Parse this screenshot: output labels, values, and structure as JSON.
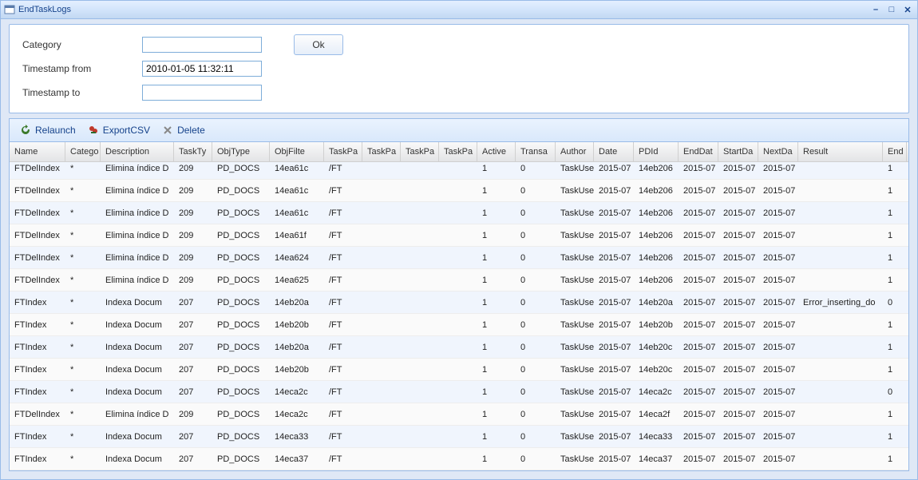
{
  "window": {
    "title": "EndTaskLogs"
  },
  "form": {
    "category_label": "Category",
    "category_value": "",
    "ts_from_label": "Timestamp from",
    "ts_from_value": "2010-01-05 11:32:11",
    "ts_to_label": "Timestamp to",
    "ts_to_value": "",
    "ok_label": "Ok"
  },
  "toolbar": {
    "relaunch": "Relaunch",
    "exportcsv": "ExportCSV",
    "delete": "Delete"
  },
  "columns": [
    "Name",
    "Catego",
    "Description",
    "TaskTy",
    "ObjType",
    "ObjFilte",
    "TaskPa",
    "TaskPa",
    "TaskPa",
    "TaskPa",
    "Active",
    "Transa",
    "Author",
    "Date",
    "PDId",
    "EndDat",
    "StartDa",
    "NextDa",
    "Result",
    "End"
  ],
  "rows": [
    {
      "name": "FTDelIndex",
      "cat": "*",
      "desc": "Elimina índice D",
      "tasktype": "209",
      "objtype": "PD_DOCS",
      "objfilter": "14ea61c",
      "tp1": "/FT",
      "tp2": "",
      "tp3": "",
      "tp4": "",
      "active": "1",
      "trans": "0",
      "author": "TaskUse",
      "date": "2015-07",
      "pdid": "14eb206",
      "enddate": "2015-07",
      "startdate": "2015-07",
      "nextdate": "2015-07",
      "result": "",
      "end": "1"
    },
    {
      "name": "FTDelIndex",
      "cat": "*",
      "desc": "Elimina índice D",
      "tasktype": "209",
      "objtype": "PD_DOCS",
      "objfilter": "14ea61c",
      "tp1": "/FT",
      "tp2": "",
      "tp3": "",
      "tp4": "",
      "active": "1",
      "trans": "0",
      "author": "TaskUse",
      "date": "2015-07",
      "pdid": "14eb206",
      "enddate": "2015-07",
      "startdate": "2015-07",
      "nextdate": "2015-07",
      "result": "",
      "end": "1"
    },
    {
      "name": "FTDelIndex",
      "cat": "*",
      "desc": "Elimina índice D",
      "tasktype": "209",
      "objtype": "PD_DOCS",
      "objfilter": "14ea61c",
      "tp1": "/FT",
      "tp2": "",
      "tp3": "",
      "tp4": "",
      "active": "1",
      "trans": "0",
      "author": "TaskUse",
      "date": "2015-07",
      "pdid": "14eb206",
      "enddate": "2015-07",
      "startdate": "2015-07",
      "nextdate": "2015-07",
      "result": "",
      "end": "1"
    },
    {
      "name": "FTDelIndex",
      "cat": "*",
      "desc": "Elimina índice D",
      "tasktype": "209",
      "objtype": "PD_DOCS",
      "objfilter": "14ea61f",
      "tp1": "/FT",
      "tp2": "",
      "tp3": "",
      "tp4": "",
      "active": "1",
      "trans": "0",
      "author": "TaskUse",
      "date": "2015-07",
      "pdid": "14eb206",
      "enddate": "2015-07",
      "startdate": "2015-07",
      "nextdate": "2015-07",
      "result": "",
      "end": "1"
    },
    {
      "name": "FTDelIndex",
      "cat": "*",
      "desc": "Elimina índice D",
      "tasktype": "209",
      "objtype": "PD_DOCS",
      "objfilter": "14ea624",
      "tp1": "/FT",
      "tp2": "",
      "tp3": "",
      "tp4": "",
      "active": "1",
      "trans": "0",
      "author": "TaskUse",
      "date": "2015-07",
      "pdid": "14eb206",
      "enddate": "2015-07",
      "startdate": "2015-07",
      "nextdate": "2015-07",
      "result": "",
      "end": "1"
    },
    {
      "name": "FTDelIndex",
      "cat": "*",
      "desc": "Elimina índice D",
      "tasktype": "209",
      "objtype": "PD_DOCS",
      "objfilter": "14ea625",
      "tp1": "/FT",
      "tp2": "",
      "tp3": "",
      "tp4": "",
      "active": "1",
      "trans": "0",
      "author": "TaskUse",
      "date": "2015-07",
      "pdid": "14eb206",
      "enddate": "2015-07",
      "startdate": "2015-07",
      "nextdate": "2015-07",
      "result": "",
      "end": "1"
    },
    {
      "name": "FTIndex",
      "cat": "*",
      "desc": "Indexa Docum",
      "tasktype": "207",
      "objtype": "PD_DOCS",
      "objfilter": "14eb20a",
      "tp1": "/FT",
      "tp2": "",
      "tp3": "",
      "tp4": "",
      "active": "1",
      "trans": "0",
      "author": "TaskUse",
      "date": "2015-07",
      "pdid": "14eb20a",
      "enddate": "2015-07",
      "startdate": "2015-07",
      "nextdate": "2015-07",
      "result": "Error_inserting_do",
      "end": "0"
    },
    {
      "name": "FTIndex",
      "cat": "*",
      "desc": "Indexa Docum",
      "tasktype": "207",
      "objtype": "PD_DOCS",
      "objfilter": "14eb20b",
      "tp1": "/FT",
      "tp2": "",
      "tp3": "",
      "tp4": "",
      "active": "1",
      "trans": "0",
      "author": "TaskUse",
      "date": "2015-07",
      "pdid": "14eb20b",
      "enddate": "2015-07",
      "startdate": "2015-07",
      "nextdate": "2015-07",
      "result": "",
      "end": "1"
    },
    {
      "name": "FTIndex",
      "cat": "*",
      "desc": "Indexa Docum",
      "tasktype": "207",
      "objtype": "PD_DOCS",
      "objfilter": "14eb20a",
      "tp1": "/FT",
      "tp2": "",
      "tp3": "",
      "tp4": "",
      "active": "1",
      "trans": "0",
      "author": "TaskUse",
      "date": "2015-07",
      "pdid": "14eb20c",
      "enddate": "2015-07",
      "startdate": "2015-07",
      "nextdate": "2015-07",
      "result": "",
      "end": "1"
    },
    {
      "name": "FTIndex",
      "cat": "*",
      "desc": "Indexa Docum",
      "tasktype": "207",
      "objtype": "PD_DOCS",
      "objfilter": "14eb20b",
      "tp1": "/FT",
      "tp2": "",
      "tp3": "",
      "tp4": "",
      "active": "1",
      "trans": "0",
      "author": "TaskUse",
      "date": "2015-07",
      "pdid": "14eb20c",
      "enddate": "2015-07",
      "startdate": "2015-07",
      "nextdate": "2015-07",
      "result": "",
      "end": "1"
    },
    {
      "name": "FTIndex",
      "cat": "*",
      "desc": "Indexa Docum",
      "tasktype": "207",
      "objtype": "PD_DOCS",
      "objfilter": "14eca2c",
      "tp1": "/FT",
      "tp2": "",
      "tp3": "",
      "tp4": "",
      "active": "1",
      "trans": "0",
      "author": "TaskUse",
      "date": "2015-07",
      "pdid": "14eca2c",
      "enddate": "2015-07",
      "startdate": "2015-07",
      "nextdate": "2015-07",
      "result": "",
      "end": "0"
    },
    {
      "name": "FTDelIndex",
      "cat": "*",
      "desc": "Elimina índice D",
      "tasktype": "209",
      "objtype": "PD_DOCS",
      "objfilter": "14eca2c",
      "tp1": "/FT",
      "tp2": "",
      "tp3": "",
      "tp4": "",
      "active": "1",
      "trans": "0",
      "author": "TaskUse",
      "date": "2015-07",
      "pdid": "14eca2f",
      "enddate": "2015-07",
      "startdate": "2015-07",
      "nextdate": "2015-07",
      "result": "",
      "end": "1"
    },
    {
      "name": "FTIndex",
      "cat": "*",
      "desc": "Indexa Docum",
      "tasktype": "207",
      "objtype": "PD_DOCS",
      "objfilter": "14eca33",
      "tp1": "/FT",
      "tp2": "",
      "tp3": "",
      "tp4": "",
      "active": "1",
      "trans": "0",
      "author": "TaskUse",
      "date": "2015-07",
      "pdid": "14eca33",
      "enddate": "2015-07",
      "startdate": "2015-07",
      "nextdate": "2015-07",
      "result": "",
      "end": "1"
    },
    {
      "name": "FTIndex",
      "cat": "*",
      "desc": "Indexa Docum",
      "tasktype": "207",
      "objtype": "PD_DOCS",
      "objfilter": "14eca37",
      "tp1": "/FT",
      "tp2": "",
      "tp3": "",
      "tp4": "",
      "active": "1",
      "trans": "0",
      "author": "TaskUse",
      "date": "2015-07",
      "pdid": "14eca37",
      "enddate": "2015-07",
      "startdate": "2015-07",
      "nextdate": "2015-07",
      "result": "",
      "end": "1"
    }
  ]
}
